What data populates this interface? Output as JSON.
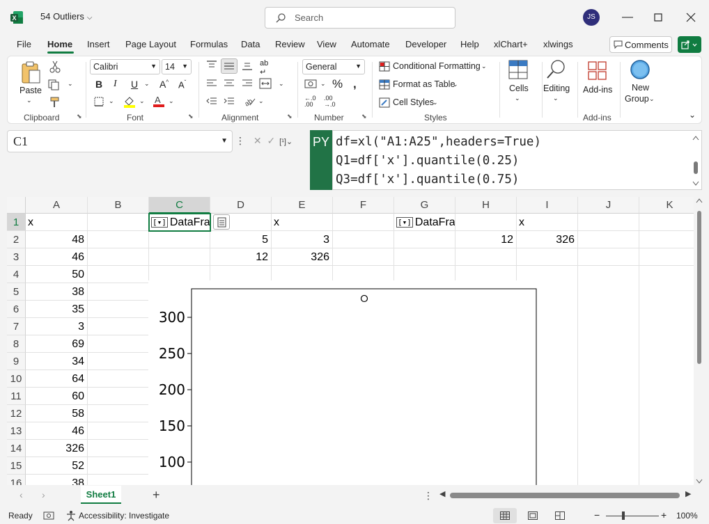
{
  "titlebar": {
    "doc_title": "54 Outliers",
    "search_placeholder": "Search",
    "user_initials": "JS"
  },
  "ribbon_tabs": [
    "File",
    "Home",
    "Insert",
    "Page Layout",
    "Formulas",
    "Data",
    "Review",
    "View",
    "Automate",
    "Developer",
    "Help",
    "xlChart+",
    "xlwings"
  ],
  "comments_label": "Comments",
  "ribbon": {
    "clipboard": {
      "paste": "Paste",
      "label": "Clipboard"
    },
    "font": {
      "name": "Calibri",
      "size": "14",
      "bold": "B",
      "italic": "I",
      "underline": "U",
      "label": "Font"
    },
    "alignment": {
      "label": "Alignment"
    },
    "number": {
      "format": "General",
      "label": "Number"
    },
    "styles": {
      "conditional": "Conditional Formatting",
      "table": "Format as Table",
      "cell_styles": "Cell Styles",
      "label": "Styles"
    },
    "cells": {
      "label": "Cells"
    },
    "editing": {
      "label": "Editing"
    },
    "addins": {
      "button": "Add-ins",
      "label": "Add-ins"
    },
    "newgroup": {
      "line1": "New",
      "line2": "Group"
    }
  },
  "formula_bar": {
    "name_box": "C1",
    "badge": "PY",
    "lines": [
      "df=xl(\"A1:A25\",headers=True)",
      "Q1=df['x'].quantile(0.25)",
      "Q3=df['x'].quantile(0.75)"
    ]
  },
  "grid": {
    "columns": [
      "A",
      "B",
      "C",
      "D",
      "E",
      "F",
      "G",
      "H",
      "I",
      "J",
      "K"
    ],
    "rows": [
      "1",
      "2",
      "3",
      "4",
      "5",
      "6",
      "7",
      "8",
      "9",
      "10",
      "11",
      "12",
      "13",
      "14",
      "15",
      "16"
    ],
    "col_a": [
      "x",
      "48",
      "46",
      "50",
      "38",
      "35",
      "3",
      "69",
      "34",
      "64",
      "60",
      "58",
      "46",
      "326",
      "52",
      "38"
    ],
    "c1": "DataFra",
    "g1": "DataFra",
    "e1": "x",
    "i1": "x",
    "d2": "5",
    "e2": "3",
    "d3": "12",
    "e3": "326",
    "h2": "12",
    "i2": "326"
  },
  "chart_data": {
    "type": "box",
    "yticks": [
      100,
      150,
      200,
      250,
      300
    ],
    "outliers": [
      326
    ]
  },
  "sheet_tab": "Sheet1",
  "status": {
    "ready": "Ready",
    "accessibility": "Accessibility: Investigate",
    "zoom": "100%"
  }
}
